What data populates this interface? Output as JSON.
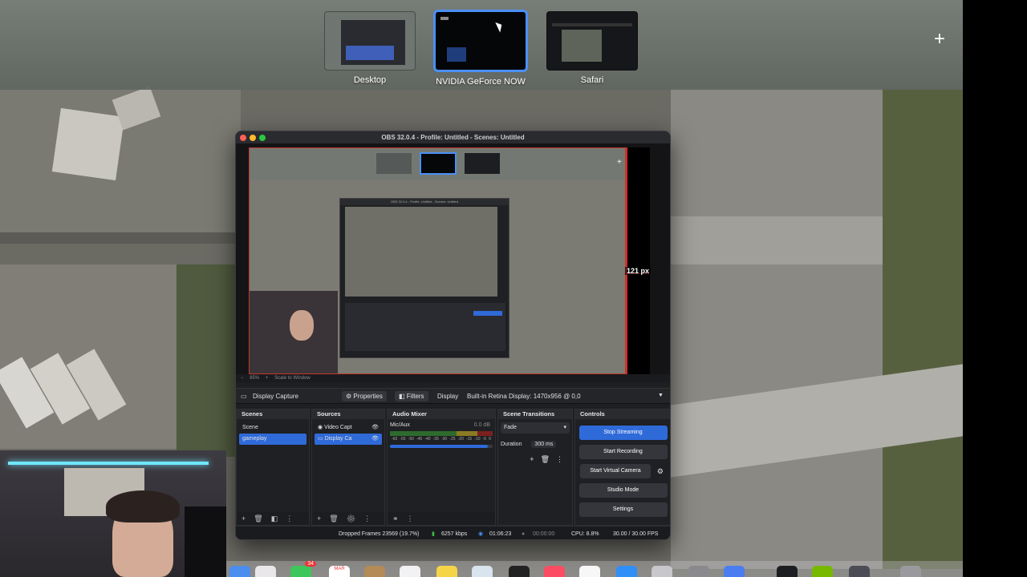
{
  "mission_control": {
    "spaces": [
      {
        "label": "Desktop",
        "active": false
      },
      {
        "label": "NVIDIA GeForce NOW",
        "active": true
      },
      {
        "label": "Safari",
        "active": false
      }
    ],
    "add_space_icon": "plus-icon"
  },
  "obs": {
    "title": "OBS 32.0.4 - Profile: Untitled - Scenes: Untitled",
    "preview": {
      "crop_readout": "121 px",
      "zoom_text": "85%",
      "scale_text": "Scale to Window",
      "nested_title": "OBS 32.0.4 - Profile: Untitled - Scenes: Untitled",
      "nested_spaces": [
        "Desktop",
        "NVIDIA GeForce NOW",
        "Safari"
      ]
    },
    "source_toolbar": {
      "source_name": "Display Capture",
      "properties_label": "Properties",
      "filters_label": "Filters",
      "display_label": "Display",
      "display_value": "Built-in Retina Display: 1470x956 @ 0,0"
    },
    "scenes": {
      "title": "Scenes",
      "items": [
        "Scene",
        "gameplay"
      ],
      "selected_index": 1
    },
    "sources": {
      "title": "Sources",
      "items": [
        "Video Capt",
        "Display Ca"
      ],
      "selected_index": 1
    },
    "audio_mixer": {
      "title": "Audio Mixer",
      "channel": "Mic/Aux",
      "level": "0.0 dB",
      "ticks": [
        "-60",
        "-55",
        "-50",
        "-45",
        "-40",
        "-35",
        "-30",
        "-25",
        "-20",
        "-15",
        "-10",
        "-5",
        "0"
      ],
      "volume": 0.95
    },
    "transitions": {
      "title": "Scene Transitions",
      "selected": "Fade",
      "duration_label": "Duration",
      "duration_value": "300 ms"
    },
    "controls": {
      "title": "Controls",
      "stop_streaming": "Stop Streaming",
      "start_recording": "Start Recording",
      "start_virtual_camera": "Start Virtual Camera",
      "studio_mode": "Studio Mode",
      "settings": "Settings"
    },
    "status": {
      "dropped_frames": "Dropped Frames 23569 (19.7%)",
      "bitrate": "6257 kbps",
      "stream_time": "01:06:23",
      "record_time": "00:00:00",
      "cpu": "CPU: 8.8%",
      "fps": "30.00 / 30.00 FPS"
    }
  },
  "dock": {
    "badges": {
      "messages": "34"
    },
    "calendar_month": "MAR"
  },
  "colors": {
    "accent_blue": "#2f6ad9",
    "obs_bg": "#1e1f22",
    "crop_red": "#d42b2b",
    "mc_selection": "#4a90f5"
  }
}
